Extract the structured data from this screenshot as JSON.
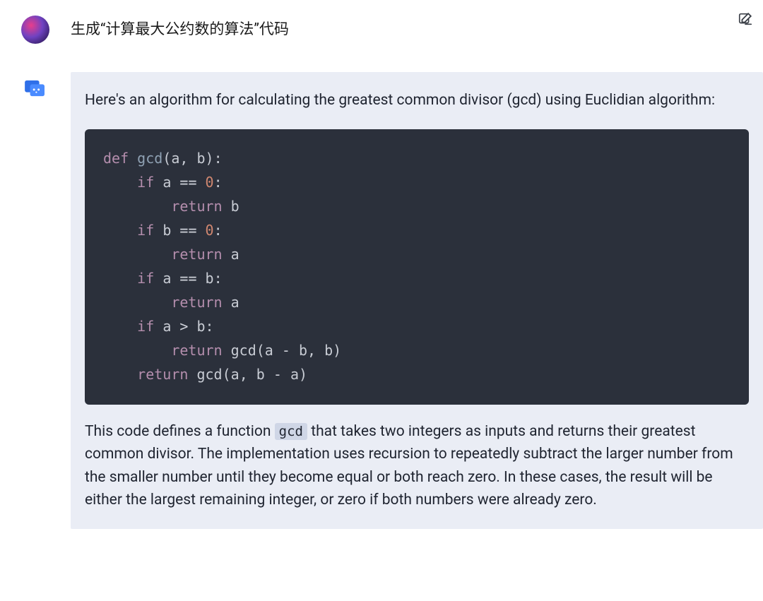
{
  "user": {
    "prompt": "生成“计算最大公约数的算法”代码"
  },
  "assistant": {
    "intro": "Here's an algorithm for calculating the greatest common divisor (gcd) using Euclidian algorithm:",
    "code": {
      "language": "python",
      "tokens": {
        "kw_def": "def",
        "fn_gcd": "gcd",
        "lp": "(",
        "a": "a",
        "comma_sp": ", ",
        "b": "b",
        "rp_colon": "):",
        "kw_if": "if",
        "sp": " ",
        "eqeq": " == ",
        "zero": "0",
        "colon": ":",
        "kw_return": "return",
        "gt": " > ",
        "minus": " - ",
        "rp": ")"
      }
    },
    "explanation_pre": "This code defines a function ",
    "inline_code": "gcd",
    "explanation_post": " that takes two integers as inputs and returns their greatest common divisor. The implementation uses recursion to repeatedly subtract the larger number from the smaller number until they become equal or both reach zero. In these cases, the result will be either the largest remaining integer, or zero if both numbers were already zero."
  },
  "icons": {
    "edit": "edit-icon",
    "user_avatar": "user-avatar",
    "assistant_avatar": "assistant-avatar"
  }
}
